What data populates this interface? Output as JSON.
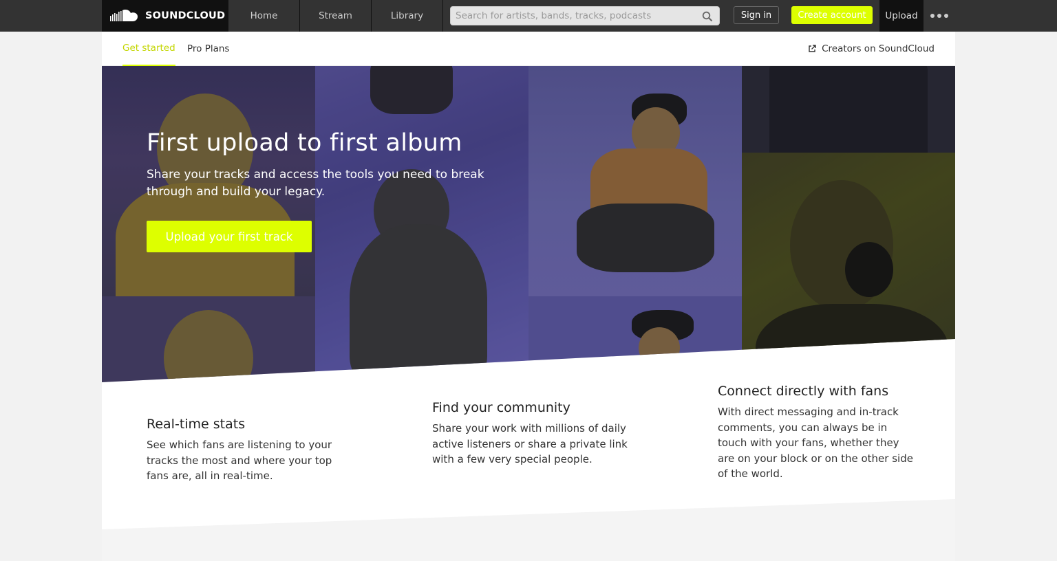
{
  "header": {
    "logo_text": "SOUNDCLOUD",
    "nav": [
      {
        "label": "Home"
      },
      {
        "label": "Stream"
      },
      {
        "label": "Library"
      }
    ],
    "search_placeholder": "Search for artists, bands, tracks, podcasts",
    "signin_label": "Sign in",
    "create_account_label": "Create account",
    "upload_label": "Upload"
  },
  "subnav": {
    "tabs": [
      {
        "label": "Get started",
        "active": true
      },
      {
        "label": "Pro Plans",
        "active": false
      }
    ],
    "creators_link": "Creators on SoundCloud"
  },
  "hero": {
    "title": "First upload to first album",
    "subtitle": "Share your tracks and access the tools you need to break through and build your legacy.",
    "cta_label": "Upload your first track"
  },
  "features": [
    {
      "title": "Real-time stats",
      "text": "See which fans are listening to your tracks the most and where your top fans are, all in real-time."
    },
    {
      "title": "Find your community",
      "text": "Share your work with millions of daily active listeners or share a private link with a few very special people."
    },
    {
      "title": "Connect directly with fans",
      "text": "With direct messaging and in-track comments, you can always be in touch with your fans, whether they are on your block or on the other side of the world."
    }
  ],
  "colors": {
    "accent": "#ddff00",
    "header_bg": "#333333",
    "logo_bg": "#111111"
  }
}
